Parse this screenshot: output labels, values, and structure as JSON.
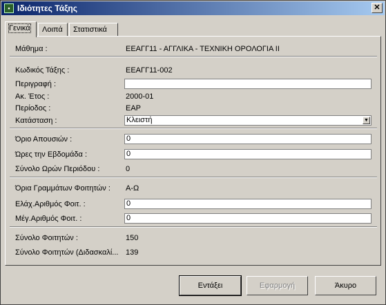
{
  "window": {
    "title": "Ιδιότητες Τάξης"
  },
  "tabs": [
    {
      "label": "Γενικά"
    },
    {
      "label": "Λοιπά"
    },
    {
      "label": "Στατιστικά"
    }
  ],
  "fields": {
    "course_label": "Μάθημα :",
    "course_value": "ΕΕΑΓΓ11 - ΑΓΓΛΙΚΑ - ΤΕΧΝΙΚΗ ΟΡΟΛΟΓΙΑ ΙΙ",
    "code_label": "Κωδικός Τάξης :",
    "code_value": "ΕΕΑΓΓ11-002",
    "description_label": "Περιγραφή :",
    "description_value": "",
    "year_label": "Ακ. Έτος :",
    "year_value": "2000-01",
    "period_label": "Περίοδος :",
    "period_value": "ΕΑΡ",
    "status_label": "Κατάσταση :",
    "status_value": "Κλειστή",
    "absence_label": "Όριο Απουσιών :",
    "absence_value": "0",
    "weekly_hours_label": "Ώρες την Εβδομάδα :",
    "weekly_hours_value": "0",
    "total_hours_label": "Σύνολο Ωρών Περιόδου :",
    "total_hours_value": "0",
    "letters_label": "Όρια Γραμμάτων Φοιτητών :",
    "letters_value": "Α-Ω",
    "min_students_label": "Ελάχ.Αριθμός Φοιτ. :",
    "min_students_value": "0",
    "max_students_label": "Μέγ.Αριθμός Φοιτ. :",
    "max_students_value": "0",
    "total_students_label": "Σύνολο Φοιτητών :",
    "total_students_value": "150",
    "total_taught_label": "Σύνολο Φοιτητών (Διδασκαλί...",
    "total_taught_value": "139"
  },
  "buttons": {
    "ok": "Εντάξει",
    "apply": "Εφαρμογή",
    "cancel": "Άκυρο"
  }
}
